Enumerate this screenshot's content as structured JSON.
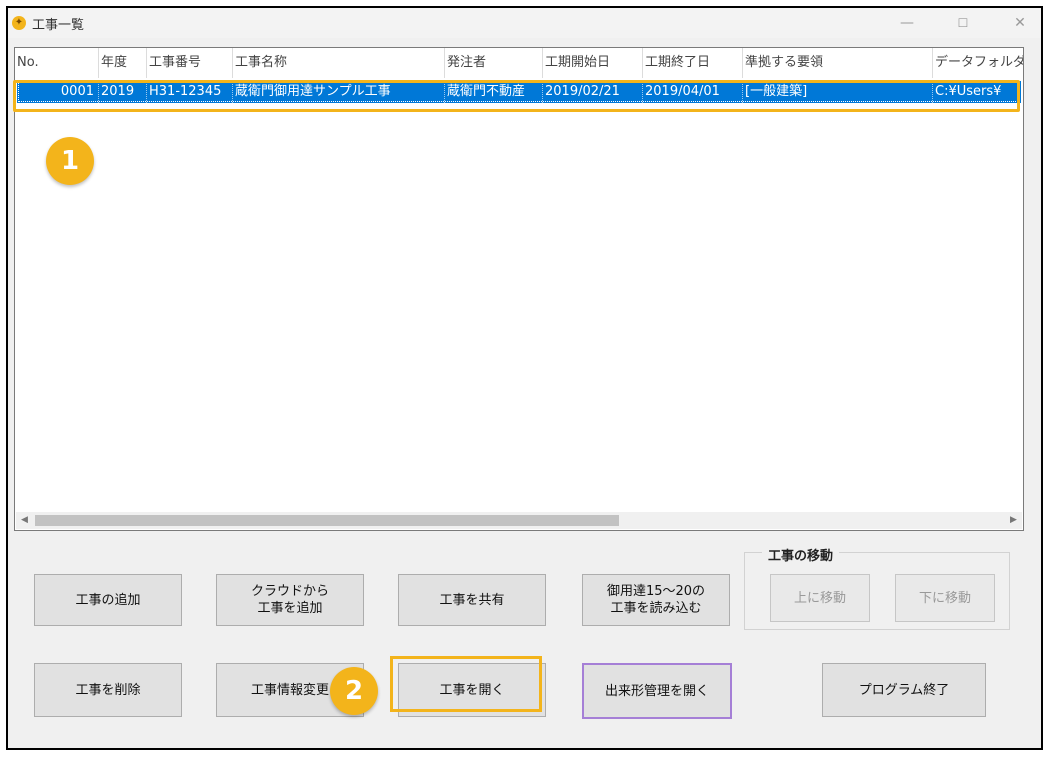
{
  "window": {
    "title": "工事一覧",
    "icon": "app-icon"
  },
  "window_controls": {
    "minimize": "—",
    "maximize": "☐",
    "close": "✕"
  },
  "table": {
    "columns": [
      "No.",
      "年度",
      "工事番号",
      "工事名称",
      "発注者",
      "工期開始日",
      "工期終了日",
      "準拠する要領",
      "データフォルダ"
    ],
    "rows": [
      [
        "0001",
        "2019",
        "H31-12345",
        "蔵衛門御用達サンプル工事",
        "蔵衛門不動産",
        "2019/02/21",
        "2019/04/01",
        "[一般建築]",
        "C:¥Users¥"
      ]
    ]
  },
  "annotations": {
    "badge1": "1",
    "badge2": "2"
  },
  "buttons": {
    "add": "工事の追加",
    "add_cloud": "クラウドから\n工事を追加",
    "share": "工事を共有",
    "import": "御用達15～20の\n工事を読み込む",
    "delete": "工事を削除",
    "edit": "工事情報変更",
    "open": "工事を開く",
    "dekigata": "出来形管理を開く",
    "exit": "プログラム終了"
  },
  "move_group": {
    "label": "工事の移動",
    "up": "上に移動",
    "down": "下に移動"
  },
  "colors": {
    "accent": "#f3b41b",
    "selection": "#0078d7",
    "purple": "#a57fd6"
  }
}
